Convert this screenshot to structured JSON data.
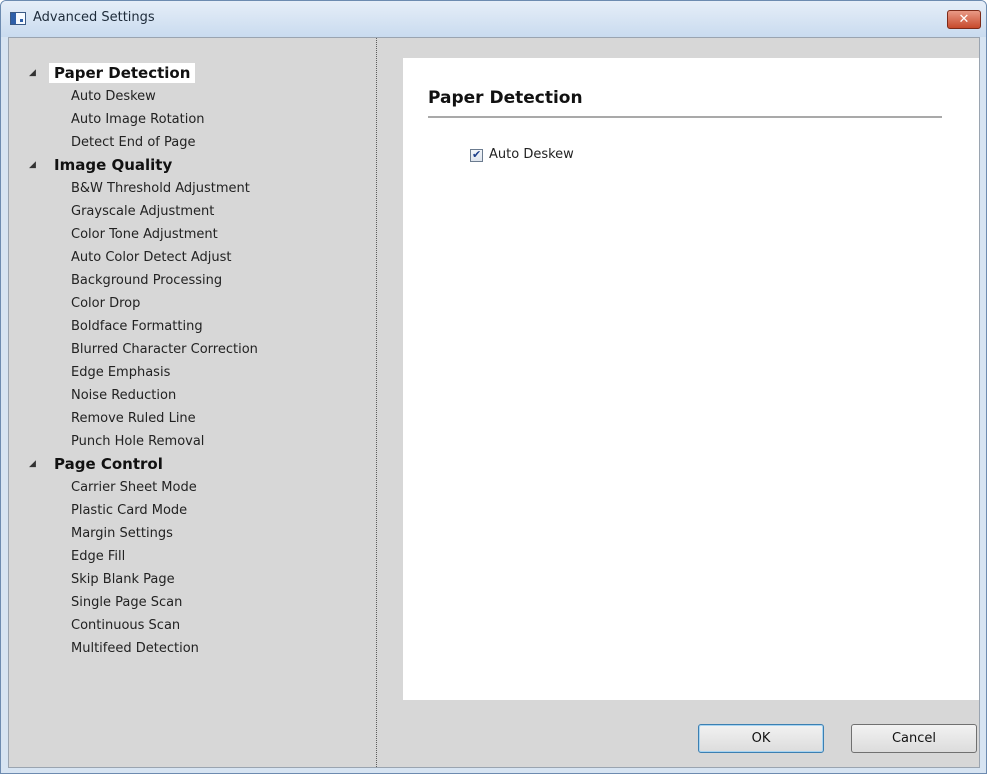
{
  "window": {
    "title": "Advanced Settings",
    "close_glyph": "✕"
  },
  "icons": {
    "expand": "◢",
    "check": "✔"
  },
  "tree": [
    {
      "label": "Paper Detection",
      "selected": true,
      "items": [
        "Auto Deskew",
        "Auto Image Rotation",
        "Detect End of Page"
      ]
    },
    {
      "label": "Image Quality",
      "selected": false,
      "items": [
        "B&W Threshold Adjustment",
        "Grayscale Adjustment",
        "Color Tone Adjustment",
        "Auto Color Detect Adjust",
        "Background Processing",
        "Color Drop",
        "Boldface Formatting",
        "Blurred Character Correction",
        "Edge Emphasis",
        "Noise Reduction",
        "Remove Ruled Line",
        "Punch Hole Removal"
      ]
    },
    {
      "label": "Page Control",
      "selected": false,
      "items": [
        "Carrier Sheet Mode",
        "Plastic Card Mode",
        "Margin Settings",
        "Edge Fill",
        "Skip Blank Page",
        "Single Page Scan",
        "Continuous Scan",
        "Multifeed Detection"
      ]
    }
  ],
  "content": {
    "title": "Paper Detection",
    "checkbox": {
      "label": "Auto Deskew",
      "checked": true
    }
  },
  "buttons": {
    "ok": "OK",
    "cancel": "Cancel"
  }
}
